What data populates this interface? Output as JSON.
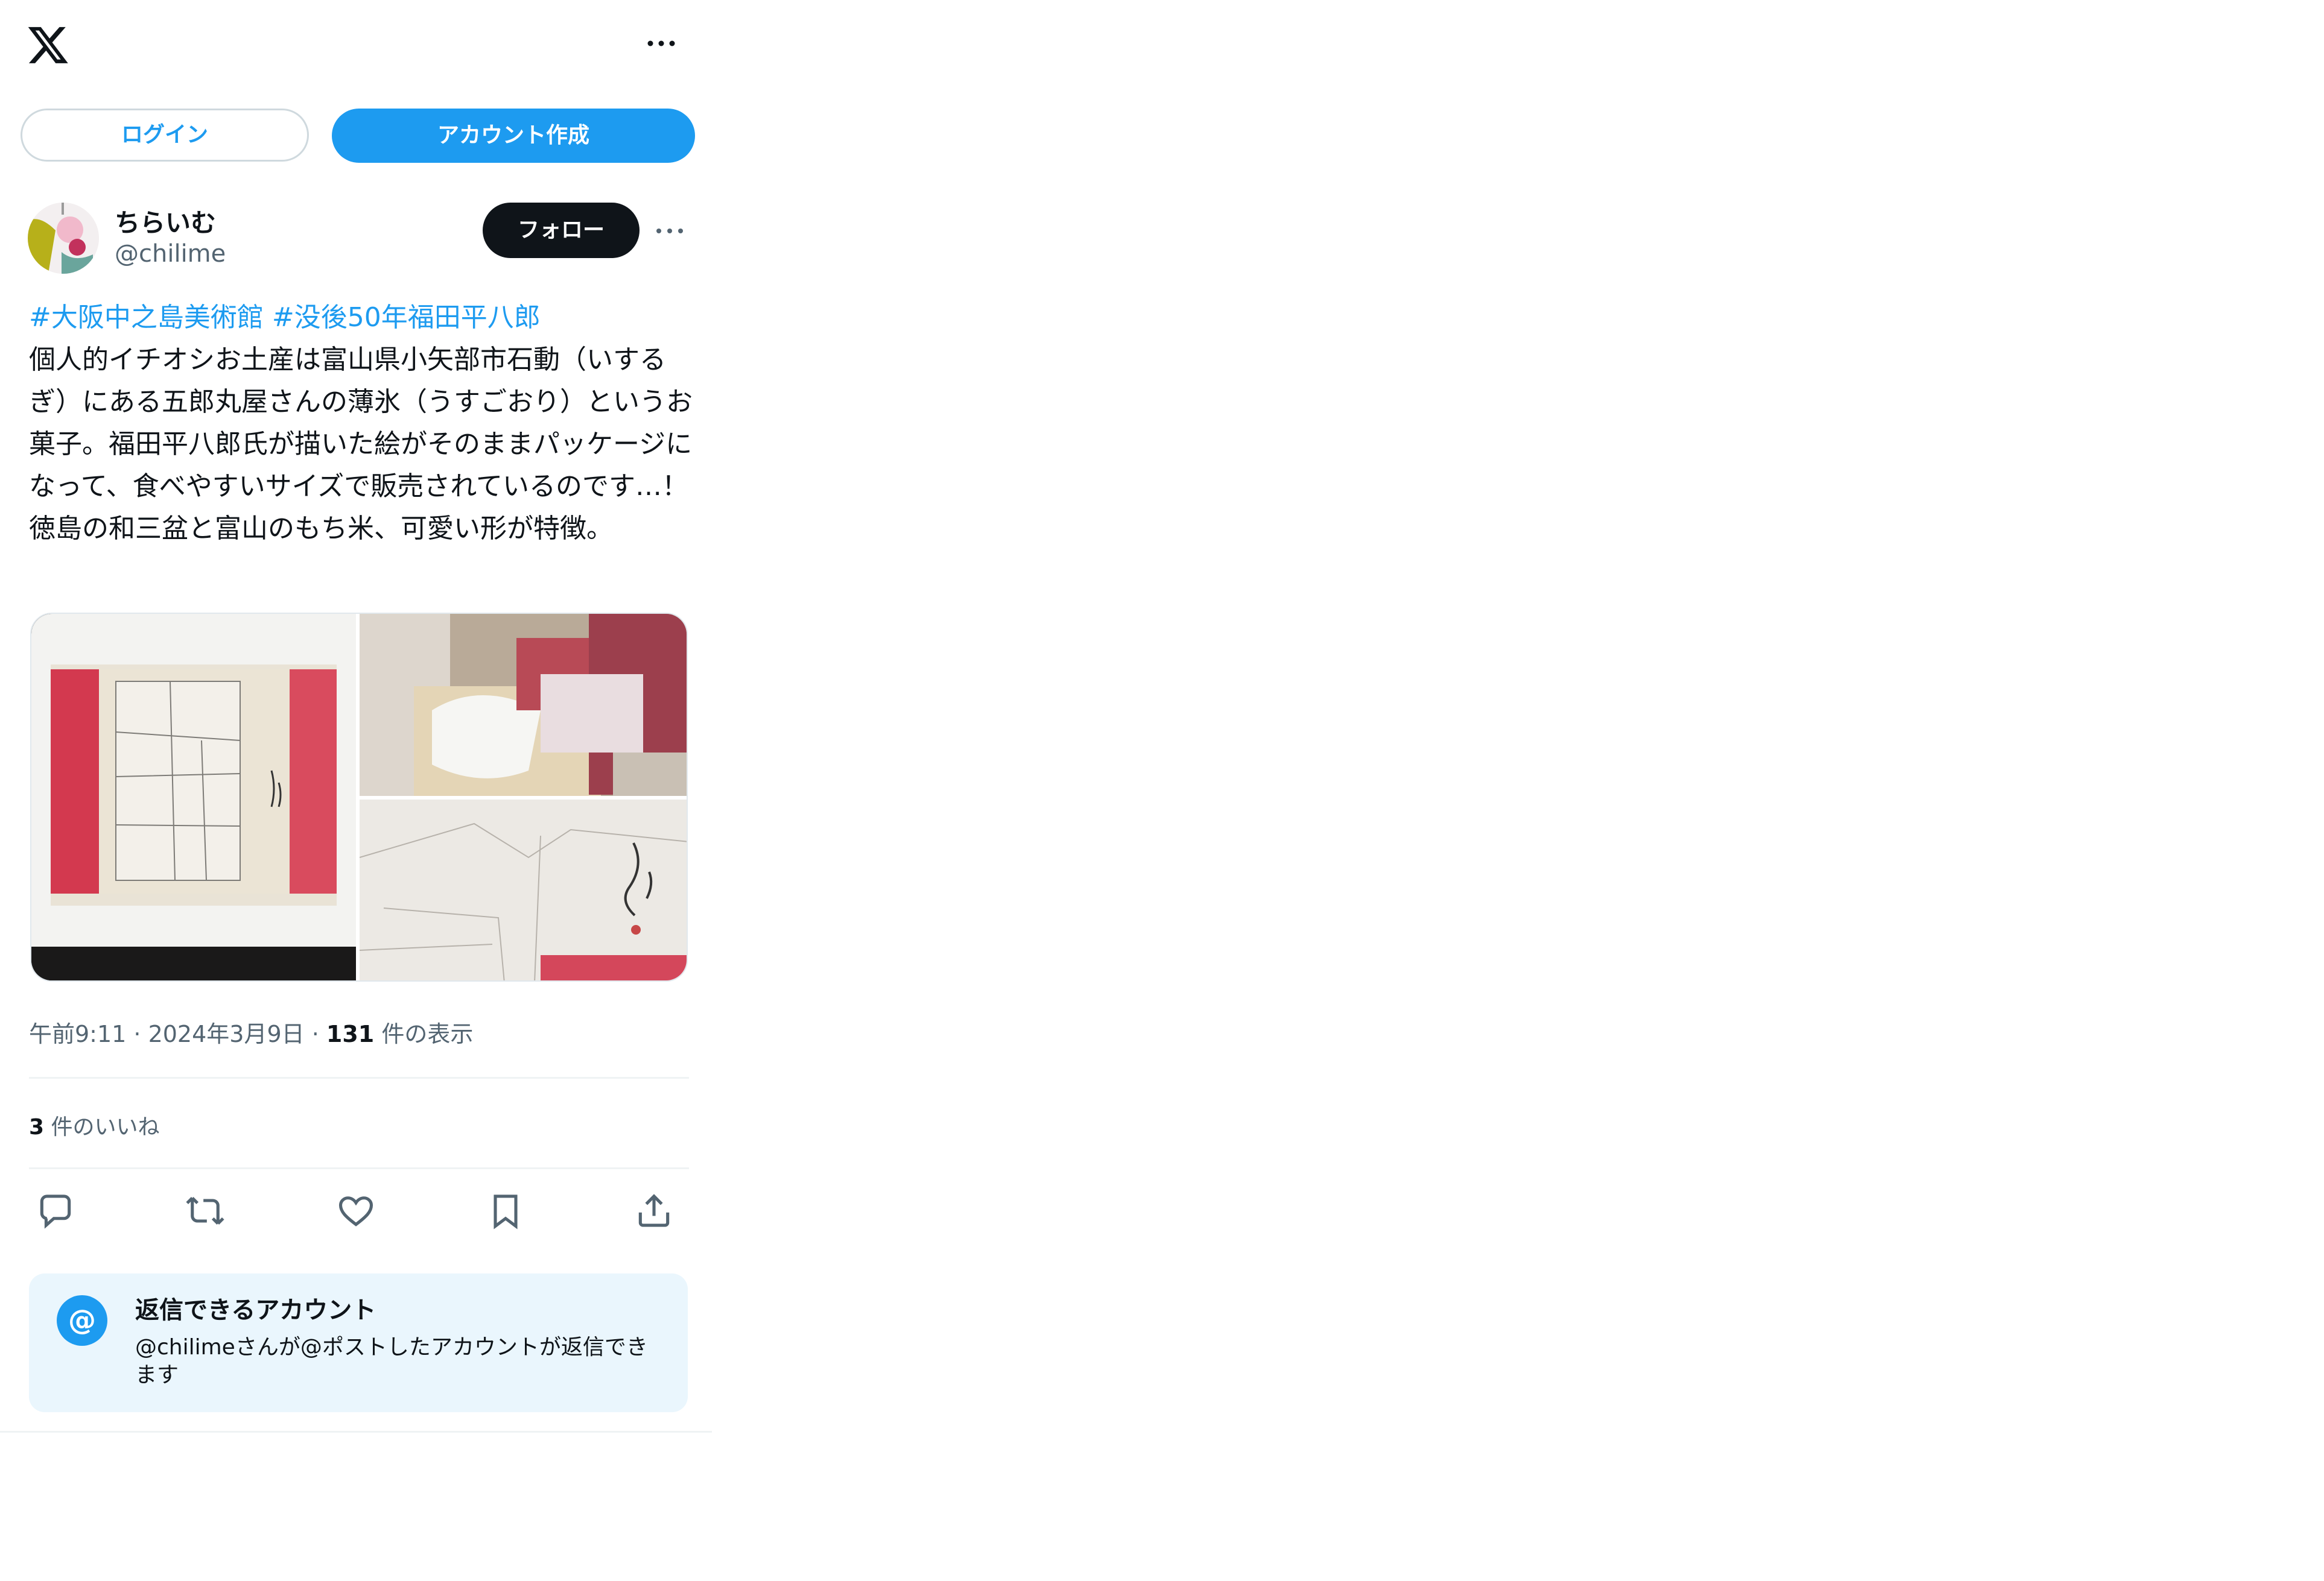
{
  "header": {
    "logo_icon": "x-logo-icon",
    "more_icon": "more-horizontal-icon"
  },
  "auth": {
    "login_label": "ログイン",
    "signup_label": "アカウント作成"
  },
  "post": {
    "author_name": "ちらいむ",
    "author_handle": "@chilime",
    "follow_label": "フォロー",
    "hashtags": [
      "#大阪中之島美術館",
      "#没後50年福田平八郎"
    ],
    "body": "個人的イチオシお土産は富山県小矢部市石動（いするぎ）にある五郎丸屋さんの薄氷（うすごおり）というお菓子。福田平八郎氏が描いた絵がそのままパッケージになって、食べやすいサイズで販売されているのです…！徳島の和三盆と富山のもち米、可愛い形が特徴。",
    "timestamp": "午前9:11 · 2024年3月9日",
    "views_count": "131",
    "views_label": " 件の表示",
    "likes_count": "3",
    "likes_label": " 件のいいね",
    "actions": [
      "reply-icon",
      "repost-icon",
      "like-icon",
      "bookmark-icon",
      "share-icon"
    ]
  },
  "reply_settings": {
    "icon_text": "@",
    "title": "返信できるアカウント",
    "description": "@chilimeさんが@ポストしたアカウントが返信できます"
  },
  "colors": {
    "accent": "#1d9bf0",
    "text": "#0f1419",
    "secondary": "#536471",
    "card_bg": "#eaf6fd"
  }
}
